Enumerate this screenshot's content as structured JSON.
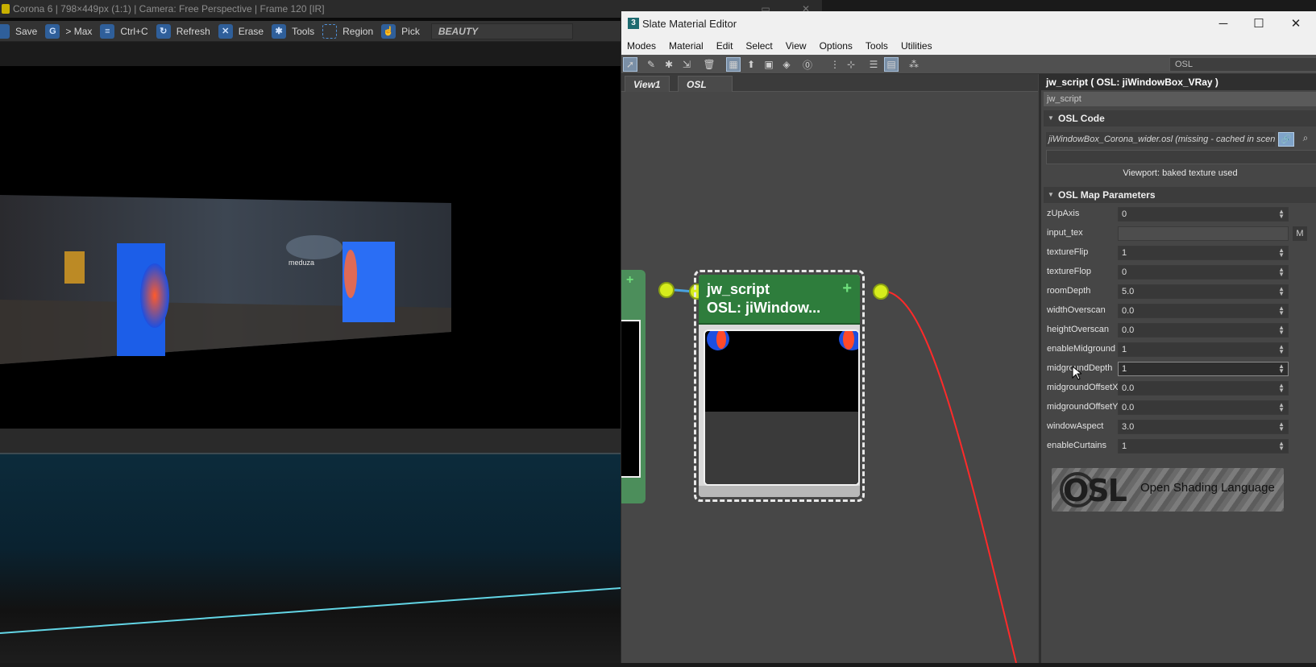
{
  "vfb": {
    "title": "Corona 6 | 798×449px (1:1) | Camera: Free Perspective | Frame 120 [IR]",
    "toolbar": [
      {
        "label": "Save",
        "icon": "save-icon"
      },
      {
        "label": "> Max",
        "icon": "to-max-icon"
      },
      {
        "label": "Ctrl+C",
        "icon": "copy-icon"
      },
      {
        "label": "Refresh",
        "icon": "refresh-icon"
      },
      {
        "label": "Erase",
        "icon": "erase-icon"
      },
      {
        "label": "Tools",
        "icon": "gear-icon"
      },
      {
        "label": "Region",
        "icon": "region-icon"
      },
      {
        "label": "Pick",
        "icon": "pick-icon"
      }
    ],
    "pass": "BEAUTY",
    "render_sign": "meduza"
  },
  "slate": {
    "title": "Slate Material Editor",
    "app_icon": "3",
    "menu": [
      "Modes",
      "Material",
      "Edit",
      "Select",
      "View",
      "Options",
      "Tools",
      "Utilities"
    ],
    "search_value": "OSL",
    "tabs": [
      "View1",
      "OSL"
    ],
    "node": {
      "name": "jw_script",
      "sub": "OSL: jiWindow...",
      "plus": "+"
    }
  },
  "panel": {
    "title": "jw_script  ( OSL: jiWindowBox_VRay )",
    "name_value": "jw_script",
    "rollout_code": "OSL Code",
    "osl_file": "jiWindowBox_Corona_wider.osl (missing - cached in scene)",
    "viewport_note": "Viewport: baked texture used",
    "rollout_params": "OSL Map Parameters",
    "map_button": "M",
    "params": [
      {
        "label": "zUpAxis",
        "value": "0"
      },
      {
        "label": "input_tex",
        "value": ""
      },
      {
        "label": "textureFlip",
        "value": "1"
      },
      {
        "label": "textureFlop",
        "value": "0"
      },
      {
        "label": "roomDepth",
        "value": "5.0"
      },
      {
        "label": "widthOverscan",
        "value": "0.0"
      },
      {
        "label": "heightOverscan",
        "value": "0.0"
      },
      {
        "label": "enableMidground",
        "value": "1"
      },
      {
        "label": "midgroundDepth",
        "value": "1"
      },
      {
        "label": "midgroundOffsetX",
        "value": "0.0"
      },
      {
        "label": "midgroundOffsetY",
        "value": "0.0"
      },
      {
        "label": "windowAspect",
        "value": "3.0"
      },
      {
        "label": "enableCurtains",
        "value": "1"
      }
    ],
    "logo_text": "Open Shading Language",
    "logo_mark": "OSL"
  },
  "colors": {
    "node_header": "#2e7d3c",
    "socket": "#d6ec1c",
    "wire_out": "#ff2a2a",
    "wire_in": "#4aa3e0",
    "accent_blue": "#2f5f9a"
  }
}
